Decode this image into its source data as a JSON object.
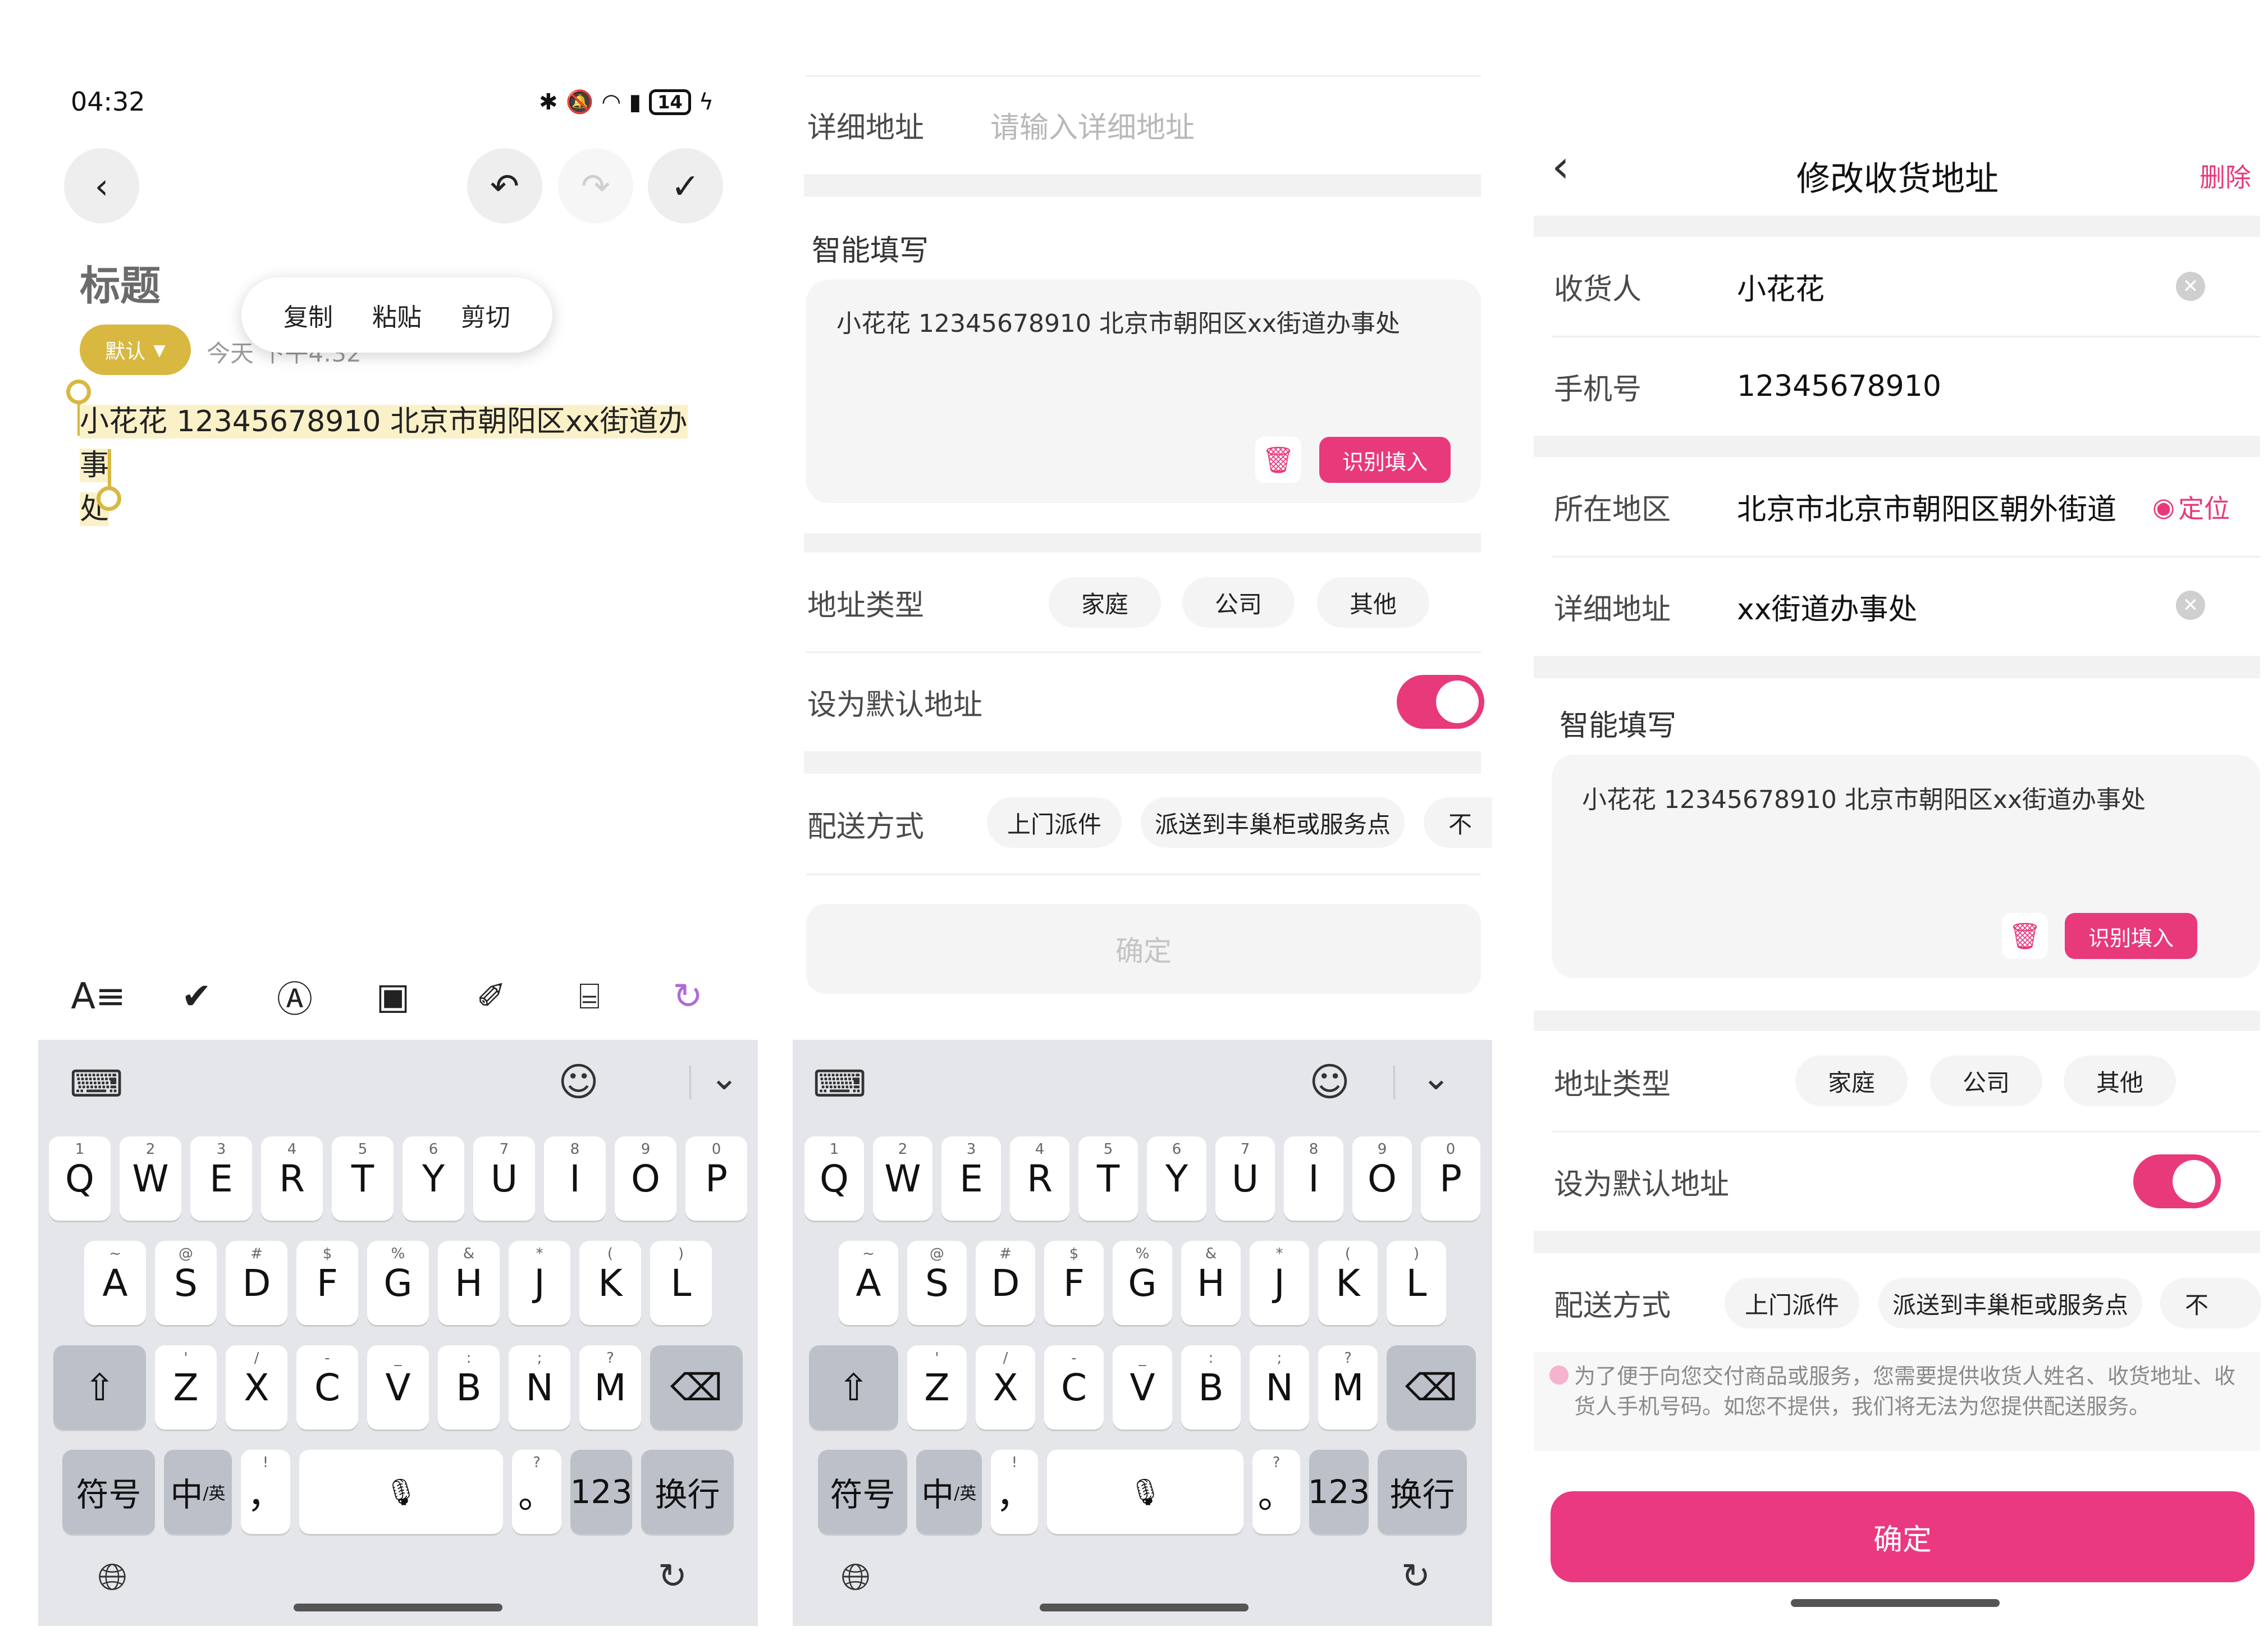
{
  "note_screen": {
    "status_time": "04:32",
    "battery": "14",
    "title_placeholder": "标题",
    "context_menu": [
      "复制",
      "粘贴",
      "剪切"
    ],
    "tag": "默认",
    "date_text": "今天 下午4:32",
    "selected_text_line1": "小花花 12345678910 北京市朝阳区xx街道办事",
    "selected_text_line2": "处",
    "toolbar_icons": [
      "text-format-icon",
      "checklist-icon",
      "handwriting-icon",
      "image-icon",
      "attachment-icon",
      "scan-text-icon",
      "ai-assistant-icon"
    ]
  },
  "keyboard": {
    "row1": [
      {
        "k": "Q",
        "h": "1"
      },
      {
        "k": "W",
        "h": "2"
      },
      {
        "k": "E",
        "h": "3"
      },
      {
        "k": "R",
        "h": "4"
      },
      {
        "k": "T",
        "h": "5"
      },
      {
        "k": "Y",
        "h": "6"
      },
      {
        "k": "U",
        "h": "7"
      },
      {
        "k": "I",
        "h": "8"
      },
      {
        "k": "O",
        "h": "9"
      },
      {
        "k": "P",
        "h": "0"
      }
    ],
    "row2": [
      {
        "k": "A",
        "h": "~"
      },
      {
        "k": "S",
        "h": "@"
      },
      {
        "k": "D",
        "h": "#"
      },
      {
        "k": "F",
        "h": "$"
      },
      {
        "k": "G",
        "h": "%"
      },
      {
        "k": "H",
        "h": "&"
      },
      {
        "k": "J",
        "h": "*"
      },
      {
        "k": "K",
        "h": "("
      },
      {
        "k": "L",
        "h": ")"
      }
    ],
    "row3": [
      {
        "k": "Z",
        "h": "'"
      },
      {
        "k": "X",
        "h": "/"
      },
      {
        "k": "C",
        "h": "-"
      },
      {
        "k": "V",
        "h": "_"
      },
      {
        "k": "B",
        "h": ":"
      },
      {
        "k": "N",
        "h": ";"
      },
      {
        "k": "M",
        "h": "?"
      }
    ],
    "symbols": "符号",
    "lang": "中",
    "lang_sub": "/英",
    "comma": "，",
    "comma_hint": "!",
    "period": "。",
    "period_hint": "?",
    "num": "123",
    "enter": "换行"
  },
  "address_form_partial": {
    "detail_label": "详细地址",
    "detail_placeholder": "请输入详细地址",
    "smart_fill_title": "智能填写",
    "smart_fill_text": "小花花 12345678910 北京市朝阳区xx街道办事处",
    "recognize_button": "识别填入",
    "address_type_label": "地址类型",
    "address_types": [
      "家庭",
      "公司",
      "其他"
    ],
    "default_label": "设为默认地址",
    "delivery_label": "配送方式",
    "delivery_options": [
      "上门派件",
      "派送到丰巢柜或服务点",
      "不"
    ],
    "confirm": "确定"
  },
  "address_form_filled": {
    "title": "修改收货地址",
    "delete": "删除",
    "receiver_label": "收货人",
    "receiver_value": "小花花",
    "phone_label": "手机号",
    "phone_value": "12345678910",
    "region_label": "所在地区",
    "region_value": "北京市北京市朝阳区朝外街道",
    "locate": "定位",
    "detail_label": "详细地址",
    "detail_value": "xx街道办事处",
    "smart_fill_title": "智能填写",
    "smart_fill_text": "小花花 12345678910 北京市朝阳区xx街道办事处",
    "recognize_button": "识别填入",
    "address_type_label": "地址类型",
    "address_types": [
      "家庭",
      "公司",
      "其他"
    ],
    "default_label": "设为默认地址",
    "delivery_label": "配送方式",
    "delivery_options": [
      "上门派件",
      "派送到丰巢柜或服务点",
      "不"
    ],
    "notice": "为了便于向您交付商品或服务，您需要提供收货人姓名、收货地址、收货人手机号码。如您不提供，我们将无法为您提供配送服务。",
    "confirm": "确定"
  },
  "colors": {
    "accent": "#e8397b",
    "tag": "#d8b840",
    "highlight": "#fbf1c8"
  }
}
